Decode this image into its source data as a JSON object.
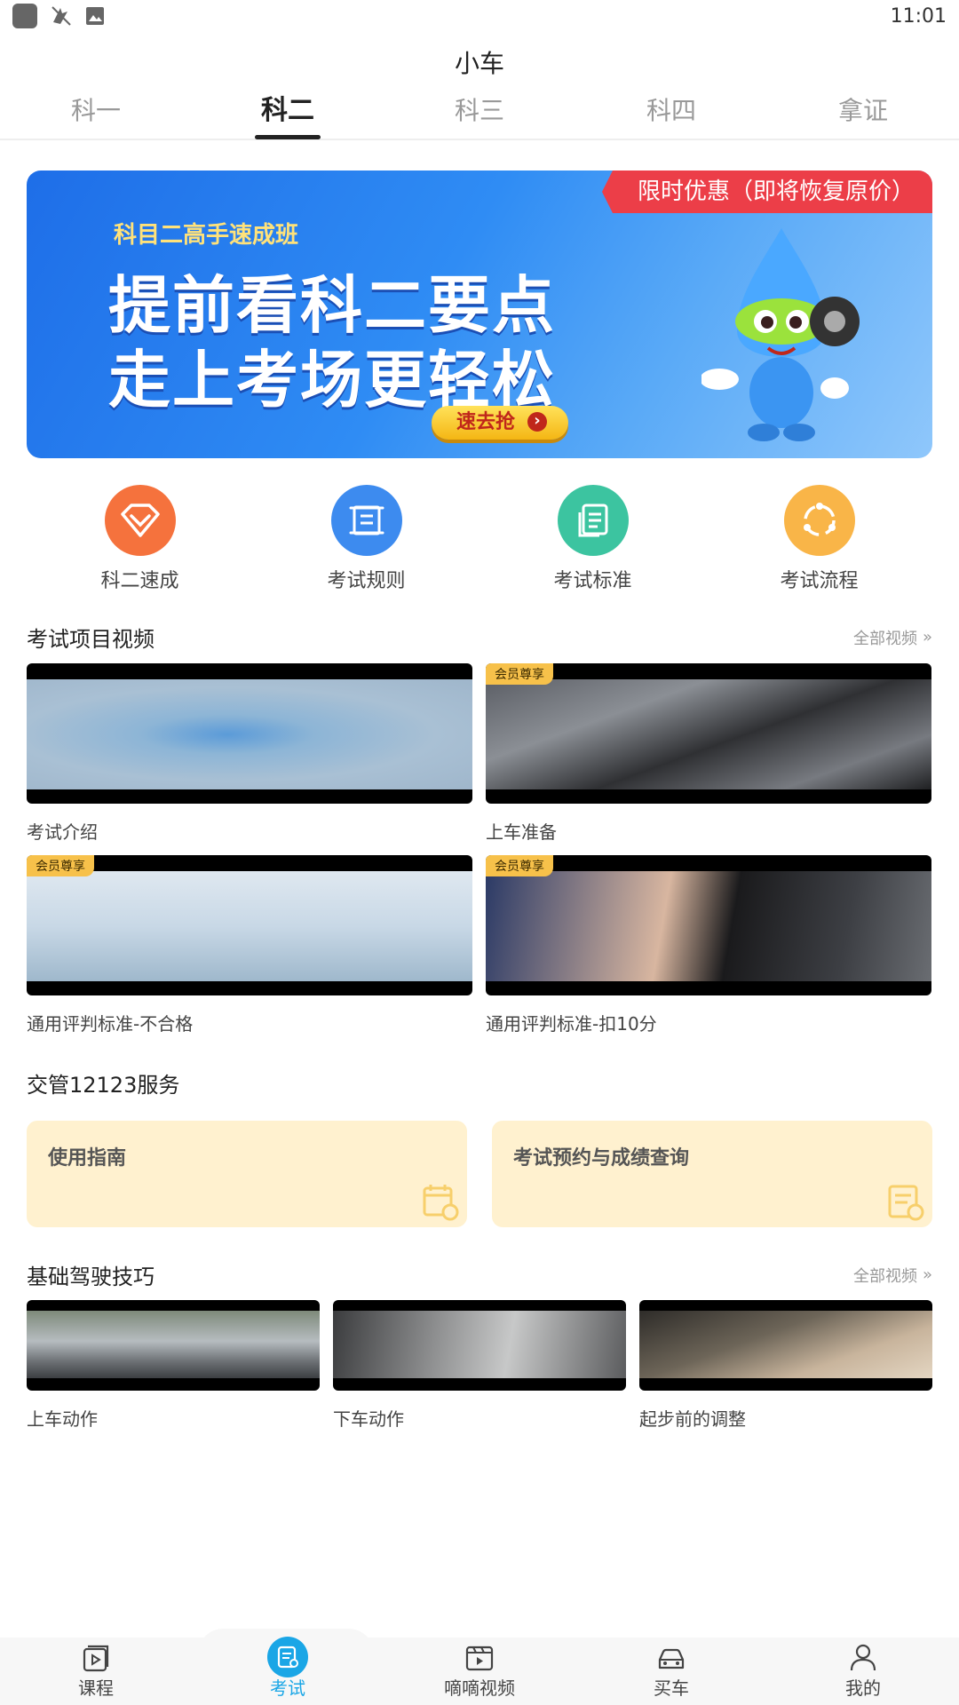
{
  "status_bar": {
    "time": "11:01"
  },
  "app_title": "小车",
  "tabs": [
    {
      "label": "科一"
    },
    {
      "label": "科二",
      "active": true
    },
    {
      "label": "科三"
    },
    {
      "label": "科四"
    },
    {
      "label": "拿证"
    }
  ],
  "banner": {
    "ribbon": "限时优惠（即将恢复原价）",
    "subtitle": "科目二高手速成班",
    "line1": "提前看科二要点",
    "line2": "走上考场更轻松",
    "button": "速去抢"
  },
  "quick_entries": [
    {
      "label": "科二速成",
      "icon": "diamond-icon",
      "color": "#f5723d"
    },
    {
      "label": "考试规则",
      "icon": "scroll-icon",
      "color": "#3d8bef"
    },
    {
      "label": "考试标准",
      "icon": "document-icon",
      "color": "#3cc4a0"
    },
    {
      "label": "考试流程",
      "icon": "cycle-icon",
      "color": "#f9b548"
    }
  ],
  "exam_videos": {
    "title": "考试项目视频",
    "more": "全部视频",
    "items": [
      {
        "title": "考试介绍",
        "badge": ""
      },
      {
        "title": "上车准备",
        "badge": "会员尊享"
      },
      {
        "title": "通用评判标准-不合格",
        "badge": "会员尊享"
      },
      {
        "title": "通用评判标准-扣10分",
        "badge": "会员尊享"
      }
    ]
  },
  "services": {
    "title": "交管12123服务",
    "items": [
      {
        "label": "使用指南"
      },
      {
        "label": "考试预约与成绩查询"
      }
    ]
  },
  "skills": {
    "title": "基础驾驶技巧",
    "more": "全部视频",
    "items": [
      {
        "title": "上车动作"
      },
      {
        "title": "下车动作"
      },
      {
        "title": "起步前的调整"
      }
    ]
  },
  "bottom_nav": [
    {
      "label": "课程",
      "icon": "course-icon"
    },
    {
      "label": "考试",
      "icon": "exam-icon",
      "active": true
    },
    {
      "label": "嘀嘀视频",
      "icon": "video-icon"
    },
    {
      "label": "买车",
      "icon": "car-icon"
    },
    {
      "label": "我的",
      "icon": "profile-icon"
    }
  ],
  "colors": {
    "accent": "#1aa6e6",
    "service_card": "#fff1cf",
    "vip_badge": "#f7c14a"
  }
}
